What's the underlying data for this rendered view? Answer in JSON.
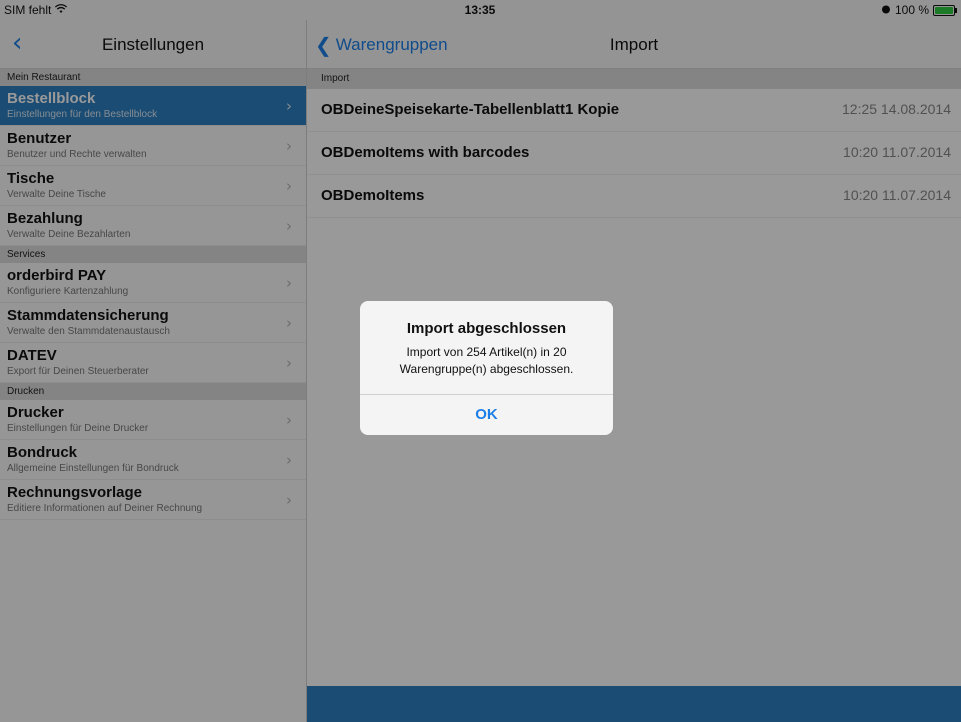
{
  "status_bar": {
    "carrier": "SIM fehlt",
    "time": "13:35",
    "battery_text": "100 %",
    "battery_level": 1.0
  },
  "master": {
    "nav_title": "Einstellungen",
    "sections": [
      {
        "header": "Mein Restaurant",
        "items": [
          {
            "title": "Bestellblock",
            "subtitle": "Einstellungen für den Bestellblock",
            "selected": true
          },
          {
            "title": "Benutzer",
            "subtitle": "Benutzer und Rechte verwalten"
          },
          {
            "title": "Tische",
            "subtitle": "Verwalte Deine Tische"
          },
          {
            "title": "Bezahlung",
            "subtitle": "Verwalte Deine Bezahlarten"
          }
        ]
      },
      {
        "header": "Services",
        "items": [
          {
            "title": "orderbird PAY",
            "subtitle": "Konfiguriere Kartenzahlung"
          },
          {
            "title": "Stammdatensicherung",
            "subtitle": "Verwalte den Stammdatenaustausch"
          },
          {
            "title": "DATEV",
            "subtitle": "Export für Deinen Steuerberater"
          }
        ]
      },
      {
        "header": "Drucken",
        "items": [
          {
            "title": "Drucker",
            "subtitle": "Einstellungen für Deine Drucker"
          },
          {
            "title": "Bondruck",
            "subtitle": "Allgemeine Einstellungen für Bondruck"
          },
          {
            "title": "Rechnungsvorlage",
            "subtitle": "Editiere Informationen auf Deiner Rechnung"
          }
        ]
      }
    ]
  },
  "detail": {
    "back_label": "Warengruppen",
    "nav_title": "Import",
    "section_header": "Import",
    "imports": [
      {
        "name": "OBDeineSpeisekarte-Tabellenblatt1 Kopie",
        "timestamp": "12:25 14.08.2014"
      },
      {
        "name": "OBDemoItems with barcodes",
        "timestamp": "10:20 11.07.2014"
      },
      {
        "name": "OBDemoItems",
        "timestamp": "10:20 11.07.2014"
      }
    ]
  },
  "alert": {
    "title": "Import abgeschlossen",
    "message": "Import von 254 Artikel(n) in 20 Warengruppe(n) abgeschlossen.",
    "ok_label": "OK"
  },
  "colors": {
    "accent": "#1c7fe8",
    "selection": "#2e7fc0"
  }
}
